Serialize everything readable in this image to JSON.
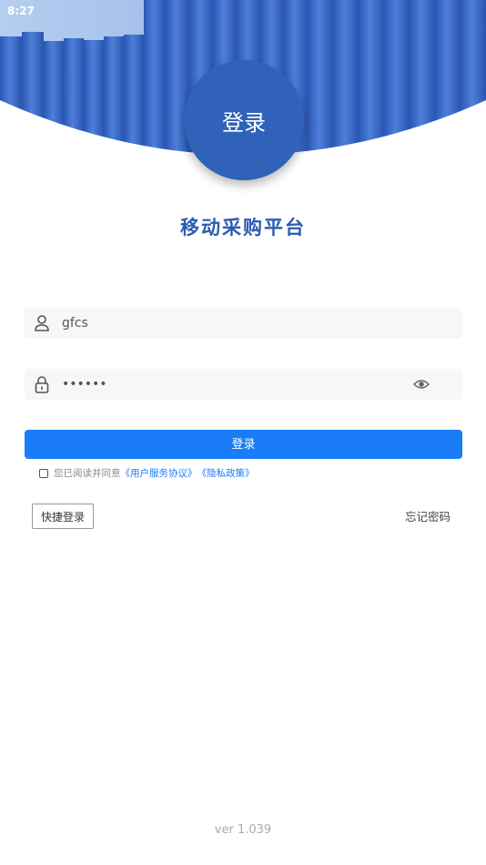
{
  "status_bar": {
    "time": "8:27"
  },
  "header": {
    "circle_label": "登录"
  },
  "app_title": "移动采购平台",
  "form": {
    "username": {
      "value": "gfcs"
    },
    "password": {
      "value": "••••••"
    },
    "login_button": "登录",
    "agreement": {
      "prefix": "您已阅读并同意",
      "user_agreement": "《用户服务协议》",
      "privacy_policy": "《隐私政策》"
    },
    "quick_login": "快捷登录",
    "forgot_password": "忘记密码"
  },
  "version": "ver 1.039",
  "colors": {
    "primary": "#1a7cf6",
    "title": "#2b5bb1",
    "circle": "#2f62b8"
  }
}
